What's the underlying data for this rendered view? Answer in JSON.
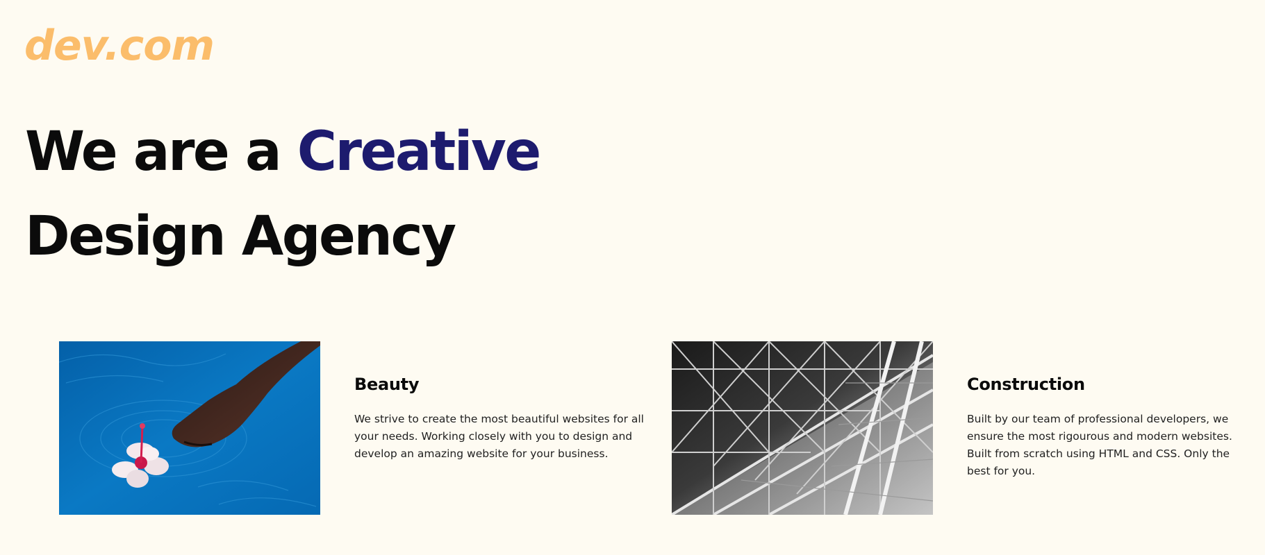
{
  "brand": {
    "logo_text": "dev.com",
    "logo_color": "#fbbd6b"
  },
  "hero": {
    "line1_prefix": "We are a ",
    "line1_highlight": "Creative",
    "line2": "Design Agency",
    "highlight_color": "#1d1b6e"
  },
  "features": [
    {
      "image_icon": "hand-in-water-with-flower-photo",
      "title": "Beauty",
      "text": "We strive to create the most beautiful websites for all your needs. Working closely with you to design and develop an amazing website for your business."
    },
    {
      "image_icon": "steel-truss-structure-photo",
      "title": "Construction",
      "text": "Built by our team of professional developers, we ensure the most rigourous and modern websites. Built from scratch using HTML and CSS. Only the best for you."
    }
  ]
}
